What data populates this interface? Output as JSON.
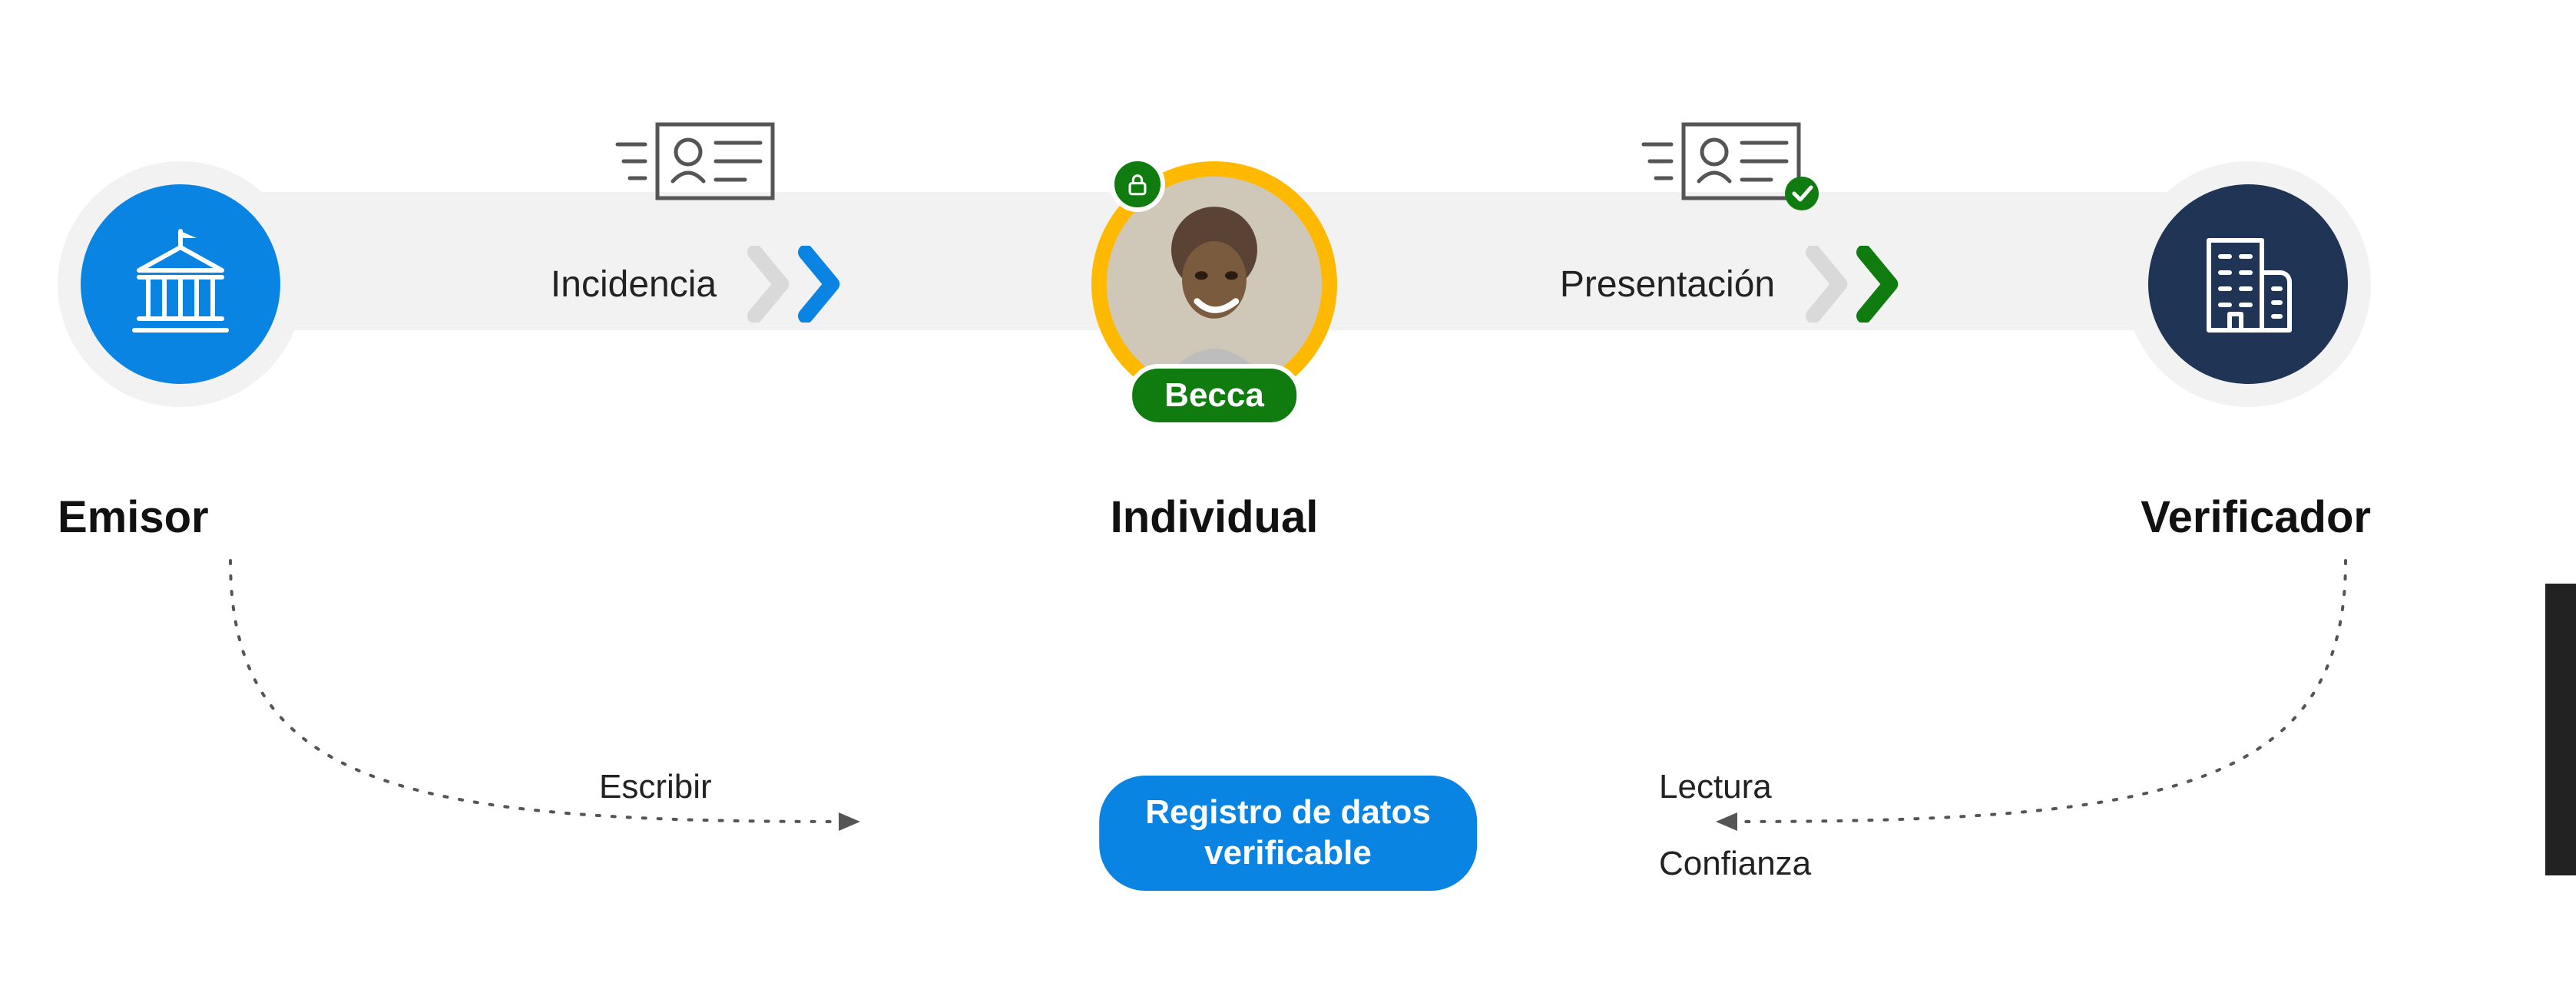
{
  "roles": {
    "issuer": "Emisor",
    "individual": "Individual",
    "verifier": "Verificador"
  },
  "individual_name": "Becca",
  "flow": {
    "issuance_label": "Incidencia",
    "presentation_label": "Presentación"
  },
  "registry": {
    "line1": "Registro de datos",
    "line2": "verificable",
    "write_label": "Escribir",
    "read_label": "Lectura",
    "trust_label": "Confianza"
  },
  "icons": {
    "issuer": "government-building-icon",
    "verifier": "office-building-icon",
    "credential": "id-card-motion-icon",
    "credential_verified": "id-card-motion-check-icon",
    "lock": "lock-icon"
  },
  "colors": {
    "issuer_blue": "#0a84e2",
    "verifier_navy": "#203556",
    "accent_yellow": "#ffb900",
    "success_green": "#107c10",
    "chevron_blue": "#0a84e2",
    "chevron_green": "#107c10",
    "chevron_gray": "#d9d9d9"
  }
}
